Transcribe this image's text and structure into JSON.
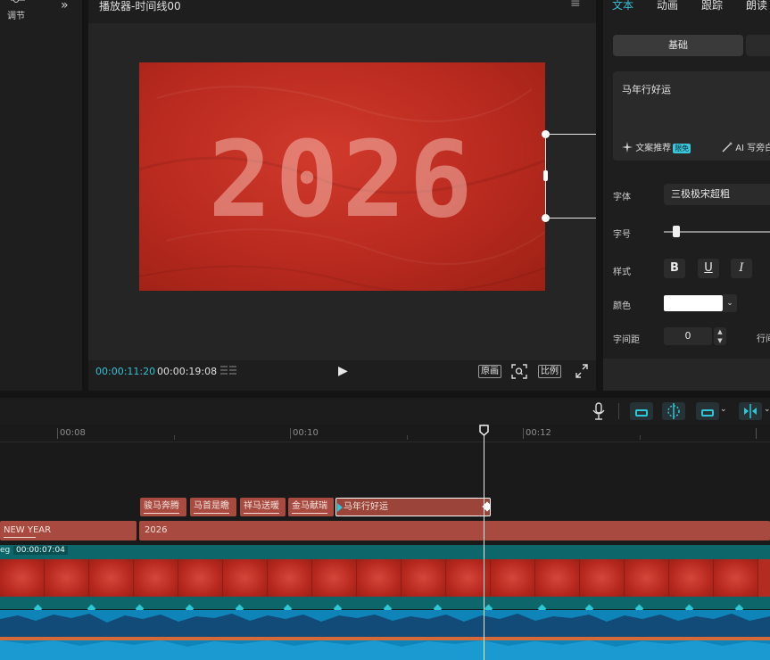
{
  "left_panel": {
    "adjust_label": "调节",
    "expand_glyph": "»"
  },
  "player": {
    "title": "播放器-时间线00",
    "menu_glyph": "≡",
    "video_text": "2026",
    "timecode_current": "00:00:11:20",
    "timecode_total": "00:00:19:08",
    "play_glyph": "▶",
    "btn_original": "原画",
    "btn_ratio": "比例"
  },
  "right_panel": {
    "tabs": [
      "文本",
      "动画",
      "跟踪",
      "朗读"
    ],
    "active_tab": "文本",
    "subtab_basic": "基础",
    "text_value": "马年行好运",
    "recommend_label": "文案推荐",
    "recommend_badge": "限免",
    "ai_label": "AI 写旁白",
    "font_label": "字体",
    "font_value": "三极极宋超粗",
    "size_label": "字号",
    "size_level": 0.08,
    "style_label": "样式",
    "style_bold": "B",
    "style_underline": "U",
    "style_italic": "I",
    "color_label": "颜色",
    "color_value": "#ffffff",
    "spacing_label": "字间距",
    "spacing_value": "0",
    "line_gap_label": "行间距"
  },
  "toolbar": {
    "mic_icon": "microphone-icon"
  },
  "timeline": {
    "ruler_labels": [
      "00:08",
      "00:10",
      "00:12"
    ],
    "text_clips": [
      "骏马奔腾",
      "马首是瞻",
      "祥马送暖",
      "金马献瑞",
      "马年行好运"
    ],
    "track2_clips": [
      "NEW YEAR",
      "2026"
    ],
    "audio_name": "eg",
    "audio_duration": "00:00:07:04"
  },
  "colors": {
    "accent": "#35c2d6",
    "clip_red": "#a84a40",
    "teal": "#0d6669",
    "audio_blue": "#0f84b8"
  }
}
